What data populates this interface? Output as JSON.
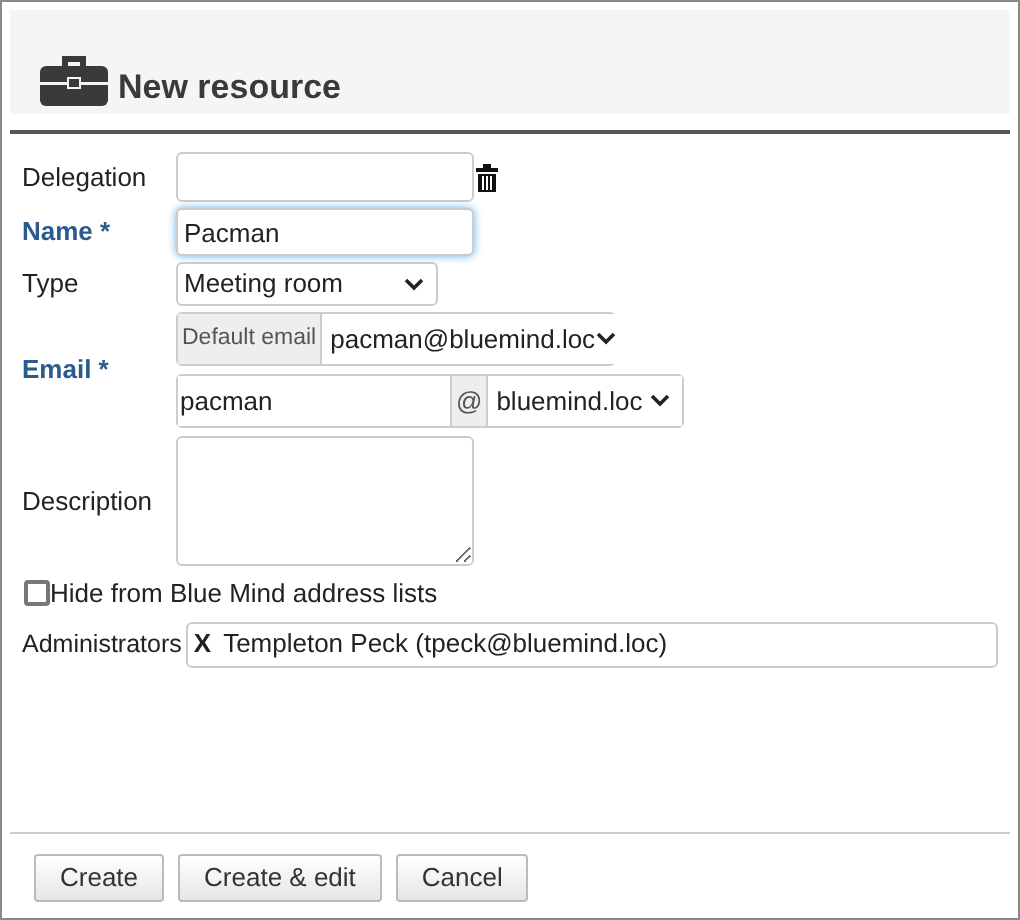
{
  "title": "New resource",
  "fields": [
    {
      "kind": "delegation",
      "label": "Delegation",
      "required": false
    },
    {
      "kind": "text",
      "label": "Name *",
      "required": true,
      "value": "Pacman",
      "focused": true
    },
    {
      "kind": "select",
      "label": "Type",
      "required": false,
      "value": "Meeting room"
    },
    {
      "kind": "email",
      "label": "Email *",
      "required": true,
      "default_label": "Default email",
      "default_value": "pacman@bluemind.loc",
      "local_part": "pacman",
      "at": "@",
      "domain": "bluemind.loc"
    },
    {
      "kind": "textarea",
      "label": "Description",
      "required": false
    }
  ],
  "hide_checkbox": {
    "label": "Hide from Blue Mind address lists",
    "checked": false
  },
  "administrators": {
    "label": "Administrators",
    "items": [
      {
        "remove": "X",
        "text": "Templeton Peck (tpeck@bluemind.loc)"
      }
    ]
  },
  "buttons": [
    "Create",
    "Create & edit",
    "Cancel"
  ]
}
